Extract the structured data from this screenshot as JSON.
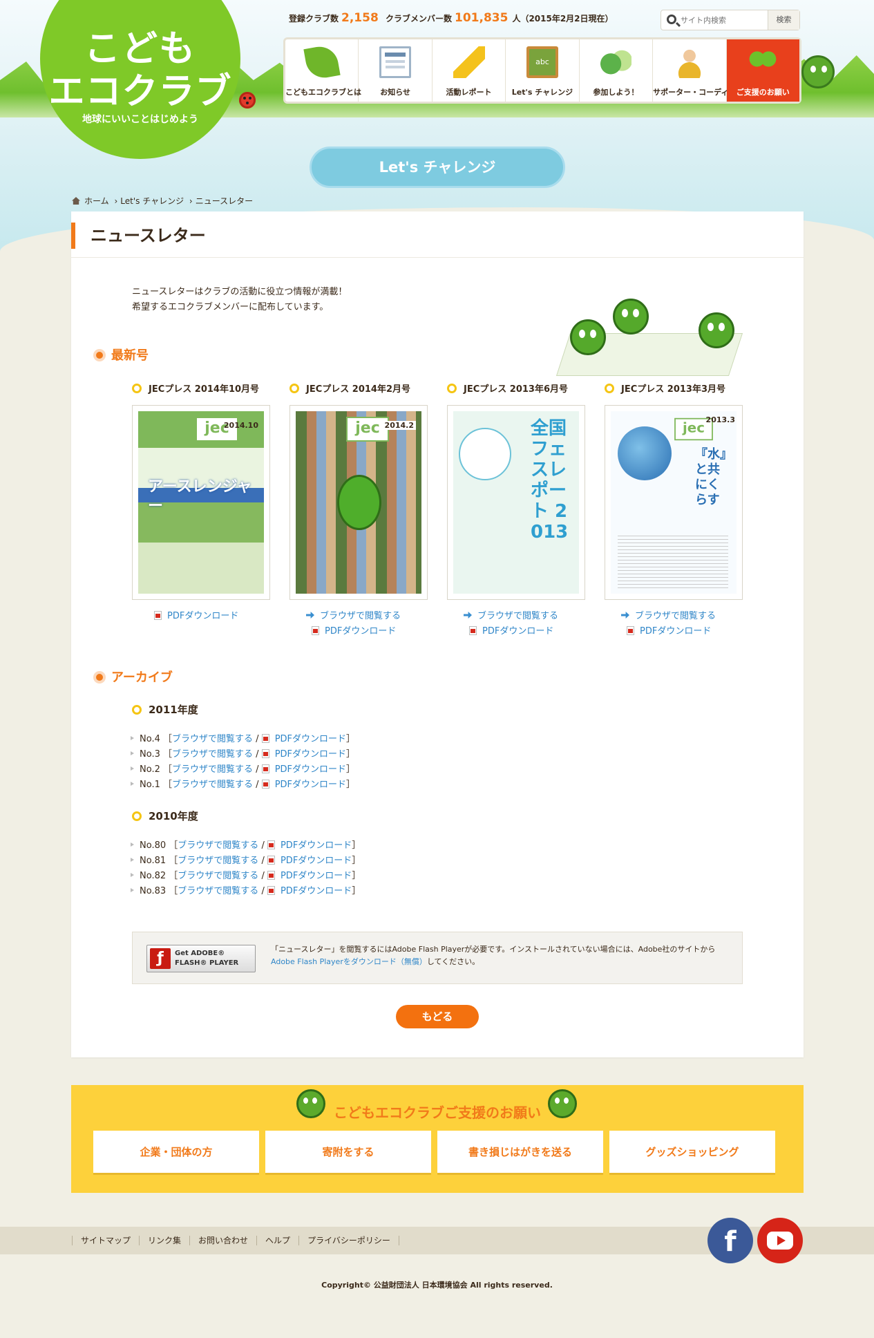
{
  "header": {
    "logo_line1": "こども",
    "logo_line2": "エコクラブ",
    "logo_tagline": "地球にいいことはじめよう",
    "stats_clubs_label": "登録クラブ数",
    "stats_clubs_value": "2,158",
    "stats_members_label": "クラブメンバー数",
    "stats_members_value": "101,835",
    "stats_note": "人（2015年2月2日現在）",
    "search_placeholder": "サイト内検索",
    "search_button": "検索"
  },
  "nav": [
    {
      "label": "こどもエコクラブとは",
      "icon": "leaf-icon"
    },
    {
      "label": "お知らせ",
      "icon": "news-icon"
    },
    {
      "label": "活動レポート",
      "icon": "pencil-icon"
    },
    {
      "label": "Let's チャレンジ",
      "icon": "blackboard-icon"
    },
    {
      "label": "参加しよう！",
      "icon": "shoes-icon"
    },
    {
      "label": "サポーター・コーディネーター",
      "icon": "person-icon"
    },
    {
      "label": "ご支援のお願い",
      "icon": "sprout-icon"
    }
  ],
  "section_banner": "Let's チャレンジ",
  "breadcrumb": {
    "home": "ホーム",
    "level1": "Let's チャレンジ",
    "current": "ニュースレター",
    "separator": "›"
  },
  "main": {
    "title": "ニュースレター",
    "intro_line1": "ニュースレターはクラブの活動に役立つ情報が満載！",
    "intro_line2": "希望するエコクラブメンバーに配布しています。",
    "latest_heading": "最新号",
    "issues": [
      {
        "title": "JECプレス 2014年10月号",
        "cover_year": "2014.10",
        "cover_headline": "アースレンジャー",
        "browse": "",
        "pdf": "PDFダウンロード"
      },
      {
        "title": "JECプレス 2014年2月号",
        "cover_year": "2014.2",
        "cover_headline": "",
        "browse": "ブラウザで閲覧する",
        "pdf": "PDFダウンロード"
      },
      {
        "title": "JECプレス 2013年6月号",
        "cover_year": "",
        "cover_headline": "全国フェスレポート 2013",
        "browse": "ブラウザで閲覧する",
        "pdf": "PDFダウンロード"
      },
      {
        "title": "JECプレス 2013年3月号",
        "cover_year": "2013.3",
        "cover_headline": "『水』と共にくらす",
        "browse": "ブラウザで閲覧する",
        "pdf": "PDFダウンロード"
      }
    ],
    "cover_logo": "jec",
    "archive_heading": "アーカイブ",
    "archive": [
      {
        "year": "2011年度",
        "items": [
          "No.4",
          "No.3",
          "No.2",
          "No.1"
        ]
      },
      {
        "year": "2010年度",
        "items": [
          "No.80",
          "No.81",
          "No.82",
          "No.83"
        ]
      }
    ],
    "archive_browse": "ブラウザで閲覧する",
    "archive_pdf": "PDFダウンロード",
    "bracket_open": "［",
    "bracket_close": "］",
    "slash": "/",
    "flash_badge_line1": "Get ADOBE® FLASH® PLAYER",
    "flash_text_before": "「ニュースレター」を閲覧するにはAdobe Flash Playerが必要です。インストールされていない場合には、Adobe社のサイトから",
    "flash_link": "Adobe Flash Playerをダウンロード（無償）",
    "flash_text_after": "してください。",
    "back_button": "もどる"
  },
  "support": {
    "heading": "こどもエコクラブご支援のお願い",
    "buttons": [
      "企業・団体の方",
      "寄附をする",
      "書き損じはがきを送る",
      "グッズショッピング"
    ]
  },
  "footer": {
    "links": [
      "サイトマップ",
      "リンク集",
      "お問い合わせ",
      "ヘルプ",
      "プライバシーポリシー"
    ],
    "facebook_glyph": "f",
    "copyright": "Copyright© 公益財団法人 日本環境協会 All rights reserved."
  },
  "colors": {
    "brand_green": "#7fc928",
    "accent_orange": "#f17a1a",
    "support_yellow": "#fdd13b",
    "nav_active_red": "#e8401c"
  }
}
